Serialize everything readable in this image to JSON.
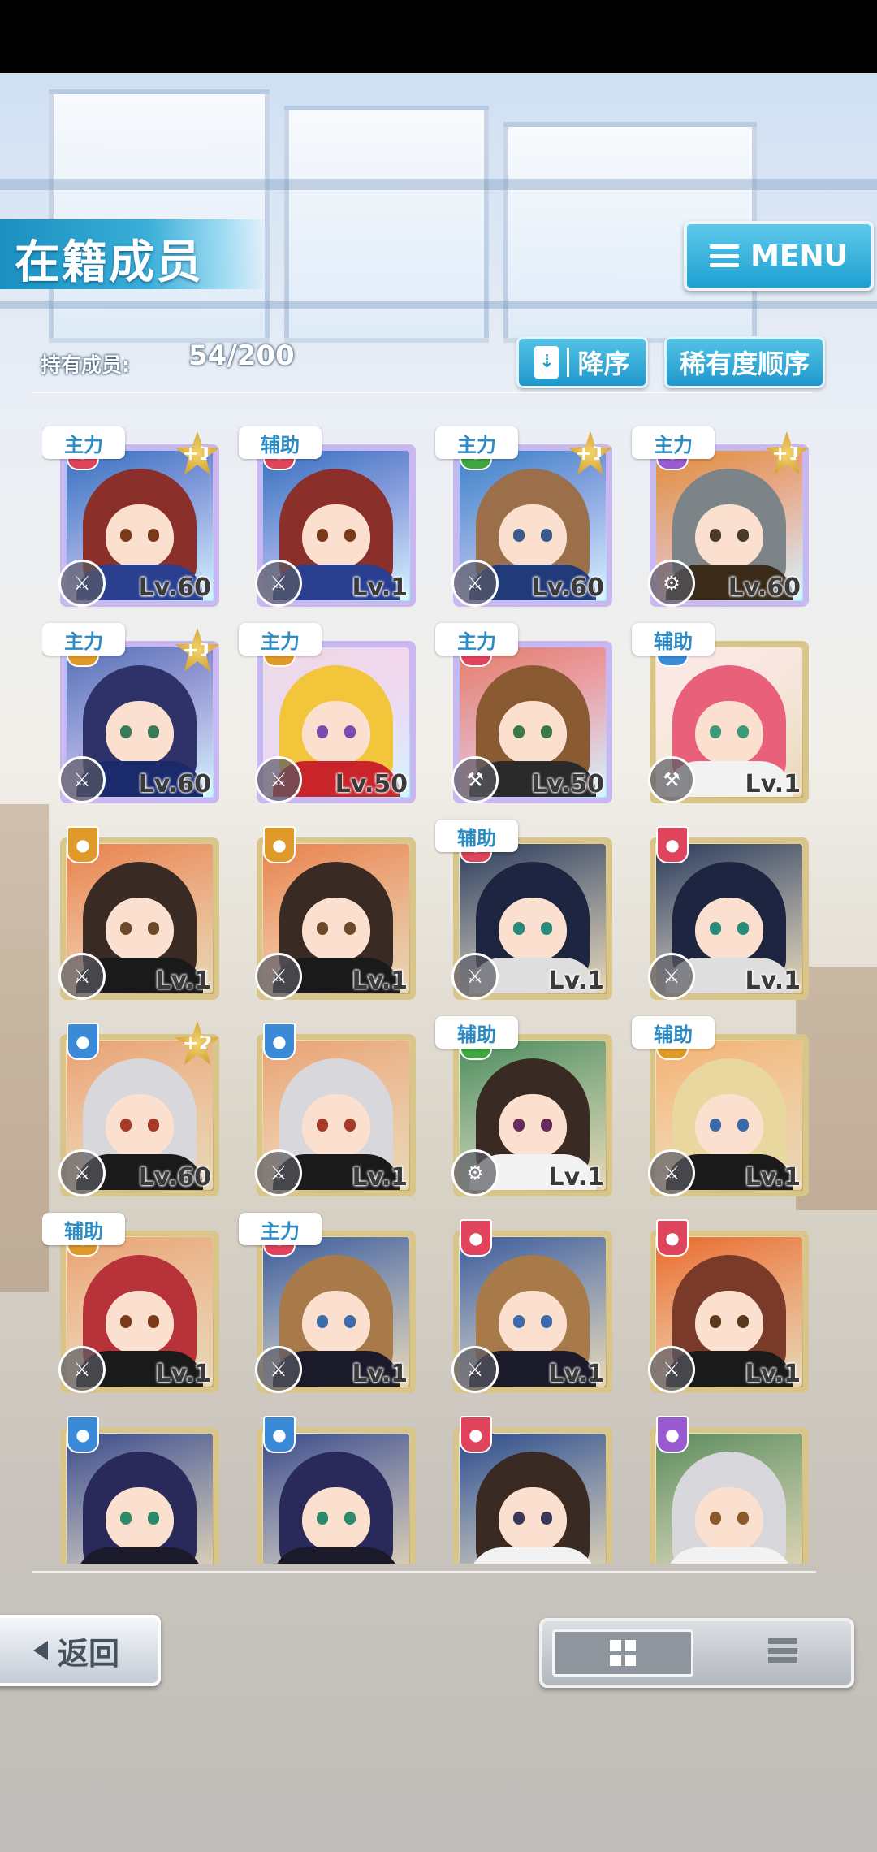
{
  "header": {
    "title": "在籍成员",
    "menu_label": "MENU"
  },
  "summary": {
    "count_label": "持有成员:",
    "count_value": "54/200"
  },
  "sort": {
    "order_label": "降序",
    "rarity_label": "稀有度顺序"
  },
  "footer": {
    "back_label": "返回"
  },
  "colors": {
    "accent": "#1ea0d2",
    "rare_frame": "#c9b7f0",
    "gold_frame": "#d8c58a"
  },
  "cards": [
    {
      "tag": "主力",
      "level": "Lv.60",
      "plus": "+1",
      "rare": true,
      "hair": "#8a2f2a",
      "eye": "#7a3a1a",
      "cloth": "#2a3f8f",
      "bg": "#3a6ec0",
      "attr": "#e0435c",
      "weapon": "sword-icon"
    },
    {
      "tag": "辅助",
      "level": "Lv.1",
      "plus": "",
      "rare": true,
      "hair": "#8a2f2a",
      "eye": "#7a3a1a",
      "cloth": "#2a3f8f",
      "bg": "#3a6ec0",
      "attr": "#e0435c",
      "weapon": "sword-icon"
    },
    {
      "tag": "主力",
      "level": "Lv.60",
      "plus": "+1",
      "rare": true,
      "hair": "#9b6f4a",
      "eye": "#3a5a8a",
      "cloth": "#203a7a",
      "bg": "#3f7fc8",
      "attr": "#3fa640",
      "weapon": "sword-icon"
    },
    {
      "tag": "主力",
      "level": "Lv.60",
      "plus": "+1",
      "rare": true,
      "hair": "#7d8488",
      "eye": "#4a3a2a",
      "cloth": "#3a2a1a",
      "bg": "#e58a3a",
      "attr": "#9a5ad0",
      "weapon": "gear-icon"
    },
    {
      "tag": "主力",
      "level": "Lv.60",
      "plus": "+1",
      "rare": true,
      "hair": "#2f3268",
      "eye": "#3a7a5a",
      "cloth": "#1a2a6a",
      "bg": "#5a6fb8",
      "attr": "#e09a2a",
      "weapon": "sword-icon"
    },
    {
      "tag": "主力",
      "level": "Lv.50",
      "plus": "",
      "rare": true,
      "hair": "#f2c53a",
      "eye": "#7a4ab0",
      "cloth": "#c8242a",
      "bg": "#f2d7e4",
      "attr": "#e09a2a",
      "weapon": "sword-icon"
    },
    {
      "tag": "主力",
      "level": "Lv.50",
      "plus": "",
      "rare": true,
      "hair": "#8a5a32",
      "eye": "#3a7a4a",
      "cloth": "#2a2a2a",
      "bg": "#e87a6a",
      "attr": "#e0435c",
      "weapon": "hammer-icon"
    },
    {
      "tag": "辅助",
      "level": "Lv.1",
      "plus": "",
      "rare": false,
      "hair": "#e8607a",
      "eye": "#3a9a7a",
      "cloth": "#f2f2f2",
      "bg": "#fbe6e6",
      "attr": "#3a8ad8",
      "weapon": "hammer-icon"
    },
    {
      "tag": "",
      "level": "Lv.1",
      "plus": "",
      "rare": false,
      "hair": "#3a2a24",
      "eye": "#6a4a2a",
      "cloth": "#1a1a1a",
      "bg": "#e8804a",
      "attr": "#e09a2a",
      "weapon": "sword-icon"
    },
    {
      "tag": "",
      "level": "Lv.1",
      "plus": "",
      "rare": false,
      "hair": "#3a2a24",
      "eye": "#6a4a2a",
      "cloth": "#1a1a1a",
      "bg": "#e8804a",
      "attr": "#e09a2a",
      "weapon": "sword-icon"
    },
    {
      "tag": "辅助",
      "level": "Lv.1",
      "plus": "",
      "rare": false,
      "hair": "#1e2540",
      "eye": "#2a8a7a",
      "cloth": "#dedede",
      "bg": "#2a3a5a",
      "attr": "#e0435c",
      "weapon": "sword-icon"
    },
    {
      "tag": "",
      "level": "Lv.1",
      "plus": "",
      "rare": false,
      "hair": "#1e2540",
      "eye": "#2a8a7a",
      "cloth": "#dedede",
      "bg": "#2a3a5a",
      "attr": "#e0435c",
      "weapon": "sword-icon"
    },
    {
      "tag": "",
      "level": "Lv.60",
      "plus": "+2",
      "rare": false,
      "hair": "#d8d8dc",
      "eye": "#a83a2a",
      "cloth": "#1a1a1a",
      "bg": "#e8a070",
      "attr": "#3a8ad8",
      "weapon": "sword-icon"
    },
    {
      "tag": "",
      "level": "Lv.1",
      "plus": "",
      "rare": false,
      "hair": "#d8d8dc",
      "eye": "#a83a2a",
      "cloth": "#1a1a1a",
      "bg": "#e8a070",
      "attr": "#3a8ad8",
      "weapon": "sword-icon"
    },
    {
      "tag": "辅助",
      "level": "Lv.1",
      "plus": "",
      "rare": false,
      "hair": "#3a2a24",
      "eye": "#6a2a5a",
      "cloth": "#f2f2f2",
      "bg": "#4a8a5a",
      "attr": "#3fa640",
      "weapon": "gear-icon"
    },
    {
      "tag": "辅助",
      "level": "Lv.1",
      "plus": "",
      "rare": false,
      "hair": "#e8d8a0",
      "eye": "#3a6aa8",
      "cloth": "#1a1a1a",
      "bg": "#f2b070",
      "attr": "#e09a2a",
      "weapon": "sword-icon"
    },
    {
      "tag": "辅助",
      "level": "Lv.1",
      "plus": "",
      "rare": false,
      "hair": "#b8323a",
      "eye": "#7a3a1a",
      "cloth": "#1a1a1a",
      "bg": "#e8a070",
      "attr": "#e09a2a",
      "weapon": "sword-icon"
    },
    {
      "tag": "主力",
      "level": "Lv.1",
      "plus": "",
      "rare": false,
      "hair": "#a87a4a",
      "eye": "#3a6aa8",
      "cloth": "#1a1a2a",
      "bg": "#3a5a9a",
      "attr": "#e0435c",
      "weapon": "sword-icon"
    },
    {
      "tag": "",
      "level": "Lv.1",
      "plus": "",
      "rare": false,
      "hair": "#a87a4a",
      "eye": "#3a6aa8",
      "cloth": "#1a1a2a",
      "bg": "#3a5a9a",
      "attr": "#e0435c",
      "weapon": "sword-icon"
    },
    {
      "tag": "",
      "level": "Lv.1",
      "plus": "",
      "rare": false,
      "hair": "#7a3a2a",
      "eye": "#5a3a1a",
      "cloth": "#1a1a1a",
      "bg": "#e86a2a",
      "attr": "#e0435c",
      "weapon": "sword-icon"
    },
    {
      "tag": "",
      "level": "",
      "plus": "",
      "rare": false,
      "hair": "#2a2a5a",
      "eye": "#2a8a6a",
      "cloth": "#1a1a2a",
      "bg": "#3a4a8a",
      "attr": "#3a8ad8",
      "weapon": ""
    },
    {
      "tag": "",
      "level": "",
      "plus": "",
      "rare": false,
      "hair": "#2a2a5a",
      "eye": "#2a8a6a",
      "cloth": "#1a1a2a",
      "bg": "#3a4a8a",
      "attr": "#3a8ad8",
      "weapon": ""
    },
    {
      "tag": "",
      "level": "",
      "plus": "",
      "rare": false,
      "hair": "#3a2a24",
      "eye": "#3a3a5a",
      "cloth": "#f2f2f2",
      "bg": "#2a4a8a",
      "attr": "#e0435c",
      "weapon": ""
    },
    {
      "tag": "",
      "level": "",
      "plus": "",
      "rare": false,
      "hair": "#d8d8dc",
      "eye": "#8a5a2a",
      "cloth": "#f2f2f2",
      "bg": "#5a8a5a",
      "attr": "#9a5ad0",
      "weapon": ""
    }
  ]
}
